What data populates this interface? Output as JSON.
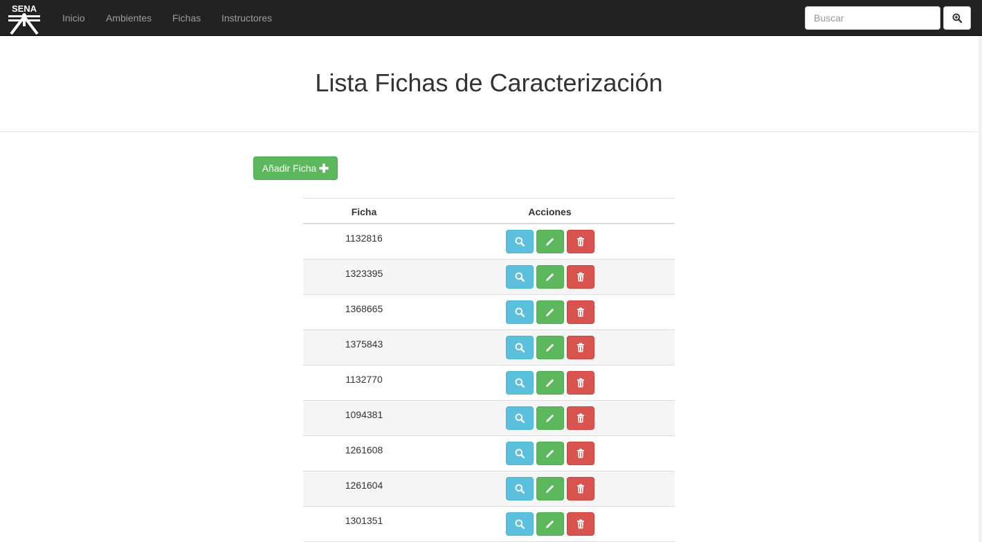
{
  "navbar": {
    "brand": "SENA",
    "brand_icon": "sena-logo",
    "links": [
      "Inicio",
      "Ambientes",
      "Fichas",
      "Instructores"
    ],
    "search_placeholder": "Buscar",
    "search_button_icon": "zoom-in-icon"
  },
  "header": {
    "title": "Lista Fichas de Caracterización"
  },
  "toolbar": {
    "add_label": "Añadir Ficha",
    "add_icon": "plus-icon"
  },
  "table": {
    "columns": [
      "Ficha",
      "Acciones"
    ],
    "rows": [
      {
        "ficha": "1132816"
      },
      {
        "ficha": "1323395"
      },
      {
        "ficha": "1368665"
      },
      {
        "ficha": "1375843"
      },
      {
        "ficha": "1132770"
      },
      {
        "ficha": "1094381"
      },
      {
        "ficha": "1261608"
      },
      {
        "ficha": "1261604"
      },
      {
        "ficha": "1301351"
      }
    ],
    "action_icons": [
      "search-icon",
      "pencil-icon",
      "trash-icon"
    ]
  },
  "colors": {
    "navbar_bg": "#222222",
    "nav_link": "#9d9d9d",
    "success": "#5cb85c",
    "info": "#5bc0de",
    "danger": "#d9534f",
    "stripe": "#f5f5f5"
  }
}
